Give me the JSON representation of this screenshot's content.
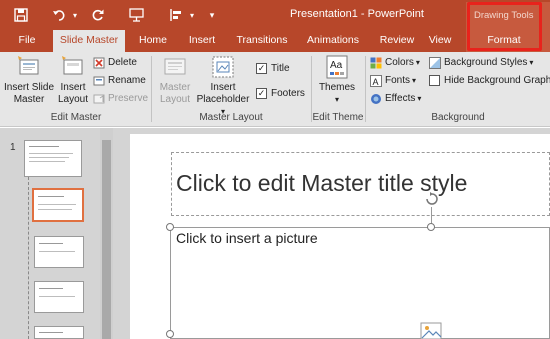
{
  "qat": {
    "save_icon": "save-icon",
    "undo_icon": "undo-icon",
    "redo_icon": "redo-icon",
    "present_icon": "present-from-start-icon",
    "layout_icon": "align-icon",
    "customize_icon": "customize-qat-icon"
  },
  "window": {
    "title": "Presentation1 - PowerPoint",
    "context_group": "Drawing Tools",
    "accent_color": "#b7472a"
  },
  "tabs": [
    {
      "label": "File"
    },
    {
      "label": "Slide Master",
      "active": true
    },
    {
      "label": "Home"
    },
    {
      "label": "Insert"
    },
    {
      "label": "Transitions"
    },
    {
      "label": "Animations"
    },
    {
      "label": "Review"
    },
    {
      "label": "View"
    },
    {
      "label": "Format",
      "contextual": true
    }
  ],
  "ribbon": {
    "edit_master": {
      "label": "Edit Master",
      "insert_slide_master_l1": "Insert Slide",
      "insert_slide_master_l2": "Master",
      "insert_layout_l1": "Insert",
      "insert_layout_l2": "Layout",
      "delete": "Delete",
      "rename": "Rename",
      "preserve": "Preserve"
    },
    "master_layout": {
      "label": "Master Layout",
      "master_layout_l1": "Master",
      "master_layout_l2": "Layout",
      "insert_placeholder_l1": "Insert",
      "insert_placeholder_l2": "Placeholder",
      "title": "Title",
      "title_checked": true,
      "footers": "Footers",
      "footers_checked": true
    },
    "edit_theme": {
      "label": "Edit Theme",
      "themes": "Themes"
    },
    "background": {
      "label": "Background",
      "colors": "Colors",
      "fonts": "Fonts",
      "effects": "Effects",
      "background_styles": "Background Styles",
      "hide_background": "Hide Background Graphi",
      "hide_background_checked": false
    }
  },
  "thumbnails": {
    "first_number": "1"
  },
  "slide": {
    "title_placeholder": "Click to edit Master title style",
    "picture_placeholder": "Click to insert a picture"
  }
}
